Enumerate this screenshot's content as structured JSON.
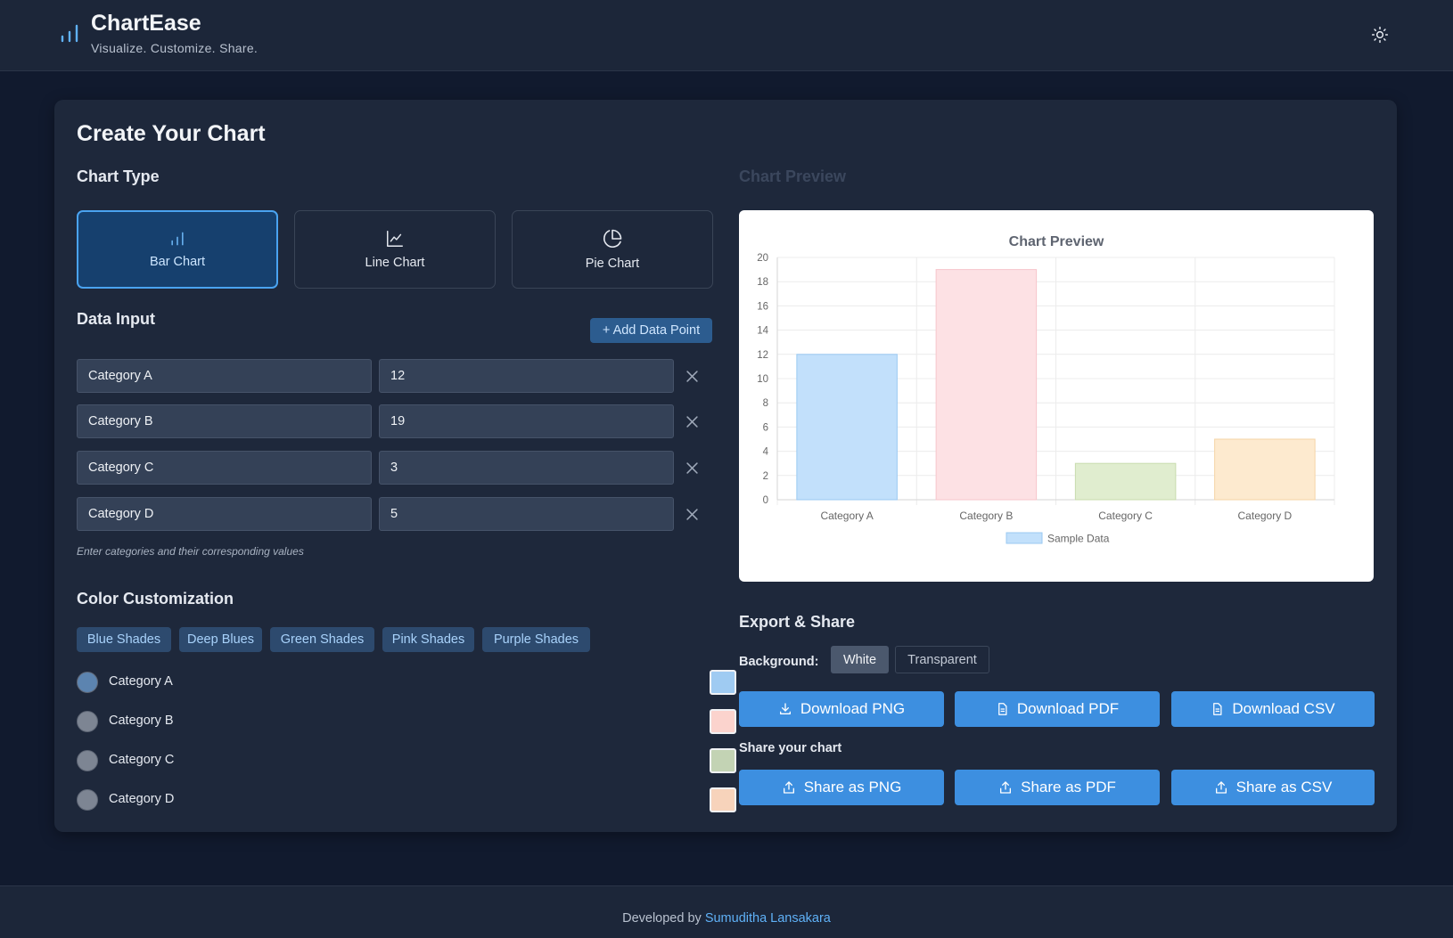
{
  "header": {
    "title": "ChartEase",
    "tagline": "Visualize. Customize. Share.",
    "logo_icon": "bar-chart-icon",
    "theme_icon": "sun-icon"
  },
  "main": {
    "title": "Create Your Chart",
    "chart_type": {
      "heading": "Chart Type",
      "options": [
        {
          "label": "Bar Chart",
          "icon": "bar-chart-icon",
          "active": true
        },
        {
          "label": "Line Chart",
          "icon": "line-chart-icon",
          "active": false
        },
        {
          "label": "Pie Chart",
          "icon": "pie-chart-icon",
          "active": false
        }
      ]
    },
    "data_input": {
      "heading": "Data Input",
      "add_label": "+ Add Data Point",
      "rows": [
        {
          "category": "Category A",
          "value": "12"
        },
        {
          "category": "Category B",
          "value": "19"
        },
        {
          "category": "Category C",
          "value": "3"
        },
        {
          "category": "Category D",
          "value": "5"
        }
      ],
      "hint": "Enter categories and their corresponding values"
    },
    "color": {
      "heading": "Color Customization",
      "presets": [
        "Blue Shades",
        "Deep Blues",
        "Green Shades",
        "Pink Shades",
        "Purple Shades"
      ],
      "items": [
        {
          "label": "Category A",
          "color": "#9fcbf2"
        },
        {
          "label": "Category B",
          "color": "#fbd3cd"
        },
        {
          "label": "Category C",
          "color": "#c3d3b4"
        },
        {
          "label": "Category D",
          "color": "#f7d3bb"
        }
      ]
    },
    "preview": {
      "heading": "Chart Preview"
    },
    "export": {
      "heading": "Export & Share",
      "background_label": "Background:",
      "background_options": [
        "White",
        "Transparent"
      ],
      "background_selected": "White",
      "download": [
        "Download PNG",
        "Download PDF",
        "Download CSV"
      ],
      "share_label": "Share your chart",
      "share": [
        "Share as PNG",
        "Share as PDF",
        "Share as CSV"
      ]
    }
  },
  "chart_data": {
    "type": "bar",
    "title": "Chart Preview",
    "categories": [
      "Category A",
      "Category B",
      "Category C",
      "Category D"
    ],
    "series": [
      {
        "name": "Sample Data",
        "values": [
          12,
          19,
          3,
          5
        ]
      }
    ],
    "colors": [
      "#c2e0fb",
      "#fde1e4",
      "#e0edcf",
      "#fdeacf"
    ],
    "border_colors": [
      "#9bc9f2",
      "#f7c5cb",
      "#c8dcae",
      "#f5d4a6"
    ],
    "ylim": [
      0,
      20
    ],
    "yticks": [
      0,
      2,
      4,
      6,
      8,
      10,
      12,
      14,
      16,
      18,
      20
    ],
    "grid": true,
    "legend": "bottom"
  },
  "footer": {
    "prefix": "Developed by ",
    "author": "Sumuditha Lansakara"
  }
}
